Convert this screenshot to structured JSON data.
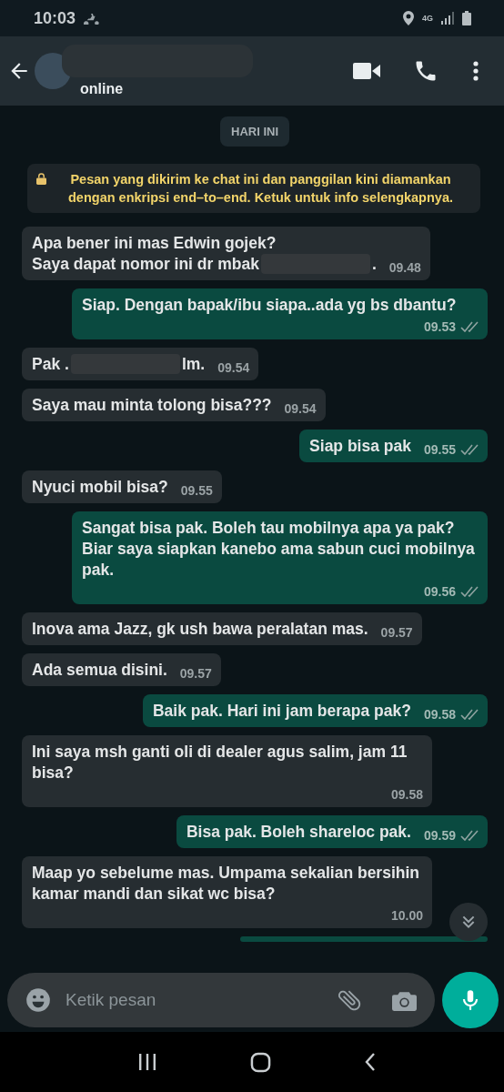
{
  "status_bar": {
    "time": "10:03",
    "network": "4G"
  },
  "header": {
    "status": "online"
  },
  "date_chip": "HARI INI",
  "notice": "Pesan yang dikirim ke chat ini dan panggilan kini diamankan dengan enkripsi end–to–end. Ketuk untuk info selengkapnya.",
  "messages": [
    {
      "kind": "incoming",
      "parts": [
        {
          "kind": "text",
          "text": "Apa bener ini mas Edwin gojek?\nSaya dapat nomor ini dr mbak"
        },
        {
          "kind": "redaction"
        },
        {
          "kind": "text",
          "text": "."
        }
      ],
      "time": "09.48"
    },
    {
      "kind": "outgoing",
      "parts": [
        {
          "kind": "text",
          "text": "Siap. Dengan bapak/ibu siapa..ada yg bs dbantu?"
        }
      ],
      "time": "09.53",
      "read": false
    },
    {
      "kind": "incoming",
      "parts": [
        {
          "kind": "text",
          "text": "Pak ."
        },
        {
          "kind": "redaction"
        },
        {
          "kind": "text",
          "text": "lm."
        }
      ],
      "time": "09.54"
    },
    {
      "kind": "incoming",
      "parts": [
        {
          "kind": "text",
          "text": "Saya mau minta tolong bisa???"
        }
      ],
      "time": "09.54"
    },
    {
      "kind": "outgoing",
      "parts": [
        {
          "kind": "text",
          "text": "Siap bisa pak"
        }
      ],
      "time": "09.55",
      "read": false
    },
    {
      "kind": "incoming",
      "parts": [
        {
          "kind": "text",
          "text": "Nyuci mobil bisa?"
        }
      ],
      "time": "09.55"
    },
    {
      "kind": "outgoing",
      "parts": [
        {
          "kind": "text",
          "text": "Sangat bisa pak. Boleh tau mobilnya apa ya pak? Biar saya siapkan kanebo ama sabun cuci mobilnya pak."
        }
      ],
      "time": "09.56",
      "read": false
    },
    {
      "kind": "incoming",
      "parts": [
        {
          "kind": "text",
          "text": "Inova ama Jazz, gk ush bawa peralatan mas."
        }
      ],
      "time": "09.57"
    },
    {
      "kind": "incoming",
      "parts": [
        {
          "kind": "text",
          "text": "Ada semua disini."
        }
      ],
      "time": "09.57"
    },
    {
      "kind": "outgoing",
      "parts": [
        {
          "kind": "text",
          "text": "Baik pak. Hari ini jam berapa pak?"
        }
      ],
      "time": "09.58",
      "read": false
    },
    {
      "kind": "incoming",
      "parts": [
        {
          "kind": "text",
          "text": "Ini saya msh ganti oli di dealer agus salim, jam 11 bisa?"
        }
      ],
      "time": "09.58"
    },
    {
      "kind": "outgoing",
      "parts": [
        {
          "kind": "text",
          "text": "Bisa pak. Boleh shareloc pak."
        }
      ],
      "time": "09.59",
      "read": false
    },
    {
      "kind": "incoming",
      "parts": [
        {
          "kind": "text",
          "text": "Maap yo sebelume mas. Umpama sekalian bersihin kamar mandi dan sikat wc bisa?"
        }
      ],
      "time": "10.00"
    }
  ],
  "composer": {
    "placeholder": "Ketik pesan"
  }
}
